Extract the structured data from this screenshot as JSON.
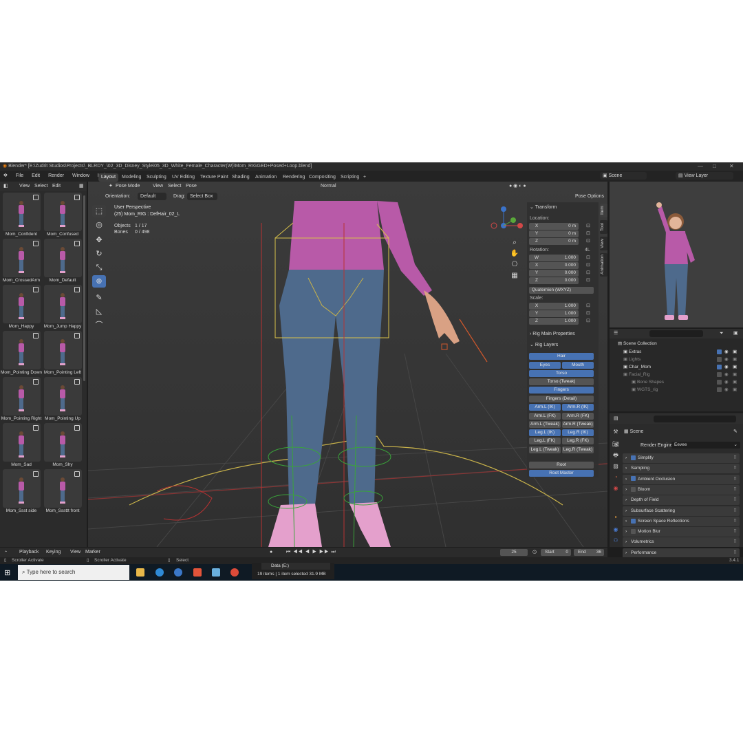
{
  "title_bar": {
    "text": "Blender* [E:\\Zudrit Studios\\Projects\\_BLRDY_\\02_3D_Disney_Style\\05_3D_White_Female_Character(W)\\Mom_RIGGED+Posed+Loop.blend]"
  },
  "menu": [
    "File",
    "Edit",
    "Render",
    "Window",
    "Help"
  ],
  "workspaces": [
    "Layout",
    "Modeling",
    "Sculpting",
    "UV Editing",
    "Texture Paint",
    "Shading",
    "Animation",
    "Rendering",
    "Compositing",
    "Scripting",
    "+"
  ],
  "scene_field": "Scene",
  "view_layer_field": "View Layer",
  "asset_header": [
    "View",
    "Select",
    "Edit"
  ],
  "viewport_header": {
    "mode": "Pose Mode",
    "menus": [
      "View",
      "Select",
      "Pose"
    ],
    "shading": "Normal",
    "orientation_label": "Orientation:",
    "orientation_value": "Default",
    "drag_label": "Drag:",
    "drag_value": "Select Box",
    "pose_options": "Pose Options"
  },
  "overlay": {
    "view": "User Perspective",
    "object": "(25) Mom_RIG : DefHair_02_L",
    "objects_label": "Objects",
    "objects_value": "1 / 17",
    "bones_label": "Bones",
    "bones_value": "0 / 498"
  },
  "poses": [
    "Mom_Confident",
    "Mom_Confused",
    "Mom_CrossedArm",
    "Mom_Default",
    "Mom_Happy",
    "Mom_Jump Happy",
    "Mom_Pointing Down",
    "Mom_Pointing Left",
    "Mom_Pointing Right",
    "Mom_Pointing Up",
    "Mom_Sad",
    "Mom_Shy",
    "Mom_Ssst side",
    "Mom_Sssttt front"
  ],
  "transform": {
    "title": "Transform",
    "location_label": "Location:",
    "location": [
      {
        "axis": "X",
        "value": "0 m"
      },
      {
        "axis": "Y",
        "value": "0 m"
      },
      {
        "axis": "Z",
        "value": "0 m"
      }
    ],
    "rotation_label": "Rotation:",
    "rotation_tag": "4L",
    "rotation": [
      {
        "axis": "W",
        "value": "1.000"
      },
      {
        "axis": "X",
        "value": "0.000"
      },
      {
        "axis": "Y",
        "value": "0.000"
      },
      {
        "axis": "Z",
        "value": "0.000"
      }
    ],
    "rotation_mode": "Quaternion (WXYZ)",
    "scale_label": "Scale:",
    "scale": [
      {
        "axis": "X",
        "value": "1.000"
      },
      {
        "axis": "Y",
        "value": "1.000"
      },
      {
        "axis": "Z",
        "value": "1.000"
      }
    ]
  },
  "rig_main_properties": "Rig Main Properties",
  "rig_layers": {
    "title": "Rig Layers",
    "buttons": {
      "hair": "Hair",
      "eyes": "Eyes",
      "mouth": "Mouth",
      "torso": "Torso",
      "torso_tweak": "Torso (Tweak)",
      "fingers": "Fingers",
      "fingers_detail": "Fingers (Detail)",
      "arm_l_ik": "Arm.L (IK)",
      "arm_r_ik": "Arm.R (IK)",
      "arm_l_fk": "Arm.L (FK)",
      "arm_r_fk": "Arm.R (FK)",
      "arm_l_tweak": "Arm.L (Tweak)",
      "arm_r_tweak": "Arm.R (Tweak)",
      "leg_l_ik": "Leg.L (IK)",
      "leg_r_ik": "Leg.R (IK)",
      "leg_l_fk": "Leg.L (FK)",
      "leg_r_fk": "Leg.R (FK)",
      "leg_l_tweak": "Leg.L (Tweak)",
      "leg_r_tweak": "Leg.R (Tweak)",
      "root": "Root",
      "root_master": "Root Master"
    }
  },
  "npanel_tabs": [
    "Item",
    "Tool",
    "View",
    "Animation"
  ],
  "outliner": {
    "root": "Scene Collection",
    "items": [
      {
        "name": "Extras",
        "checked": true
      },
      {
        "name": "Lights",
        "checked": false
      },
      {
        "name": "Char_Mom",
        "checked": true
      },
      {
        "name": "Facial_Rig",
        "checked": false
      },
      {
        "name": "Bone Shapes",
        "checked": false
      },
      {
        "name": "WGTS_rig",
        "checked": false
      }
    ]
  },
  "properties": {
    "scene_label": "Scene",
    "render_engine_label": "Render Engine",
    "render_engine_value": "Eevee",
    "sections": [
      {
        "label": "Simplify",
        "checkbox": true,
        "checked": true
      },
      {
        "label": "Sampling",
        "checkbox": false,
        "checked": false
      },
      {
        "label": "Ambient Occlusion",
        "checkbox": true,
        "checked": true
      },
      {
        "label": "Bloom",
        "checkbox": true,
        "checked": false
      },
      {
        "label": "Depth of Field",
        "checkbox": false,
        "checked": false
      },
      {
        "label": "Subsurface Scattering",
        "checkbox": false,
        "checked": false
      },
      {
        "label": "Screen Space Reflections",
        "checkbox": true,
        "checked": true
      },
      {
        "label": "Motion Blur",
        "checkbox": true,
        "checked": false
      },
      {
        "label": "Volumetrics",
        "checkbox": false,
        "checked": false
      },
      {
        "label": "Performance",
        "checkbox": false,
        "checked": false
      }
    ]
  },
  "timeline": {
    "menus": [
      "Playback",
      "Keying",
      "View",
      "Marker"
    ],
    "frame": "25",
    "start_label": "Start",
    "start": "0",
    "end_label": "End",
    "end": "36"
  },
  "status_bar": {
    "left1": "Scroller Activate",
    "left2": "Scroller Activate",
    "mid": "Select",
    "version": "3.4.1"
  },
  "taskbar": {
    "search_placeholder": "Type here to search",
    "explorer_title": "Data (E:)",
    "explorer_status": "19 items   |   1 item selected  31.9 MB"
  },
  "colors": {
    "accent": "#4772b3",
    "bg": "#1d1d1d",
    "panel": "#303030",
    "shirt": "#b85aa8",
    "jeans": "#4e6a8c",
    "shoes": "#e4a0cc"
  }
}
